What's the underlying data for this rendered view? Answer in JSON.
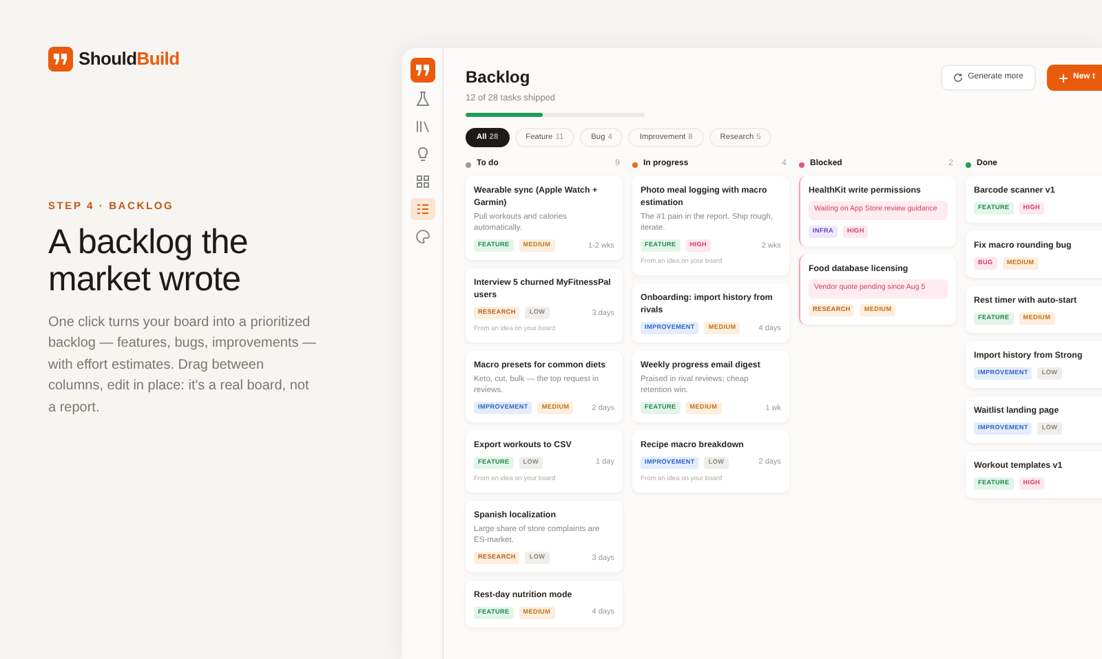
{
  "brand": {
    "name": "Should",
    "accent": "Build"
  },
  "intro": {
    "step": "STEP 4 · BACKLOG",
    "heading": "A backlog the market wrote",
    "body": "One click turns your board into a prioritized backlog — features, bugs, improvements — with effort estimates. Drag between columns, edit in place: it's a real board, not a report."
  },
  "sidebar": {
    "items": [
      {
        "kind": "flask",
        "selected": false
      },
      {
        "kind": "books",
        "selected": false
      },
      {
        "kind": "bulb",
        "selected": false
      },
      {
        "kind": "grid",
        "selected": false
      },
      {
        "kind": "list",
        "selected": true
      },
      {
        "kind": "palette",
        "selected": false
      }
    ]
  },
  "board": {
    "title": "Backlog",
    "subtitle": "12 of 28 tasks shipped",
    "progress": {
      "level": 0.43
    },
    "actions": [
      {
        "kind": "secondary",
        "label": "Generate more"
      },
      {
        "kind": "primary",
        "label": "New t"
      }
    ],
    "filters": [
      {
        "label": "All",
        "count": "28",
        "selected": true
      },
      {
        "label": "Feature",
        "count": "11",
        "selected": false
      },
      {
        "label": "Bug",
        "count": "4",
        "selected": false
      },
      {
        "label": "Improvement",
        "count": "8",
        "selected": false
      },
      {
        "label": "Research",
        "count": "5",
        "selected": false
      }
    ],
    "columns": [
      {
        "title": "To do",
        "count": "9",
        "color": "#9e9a94",
        "cards": [
          {
            "title": "Wearable sync (Apple Watch + Garmin)",
            "description": "Pull workouts and calories automatically.",
            "tags": [
              {
                "kind": "feature",
                "label": "FEATURE"
              },
              {
                "kind": "medium",
                "label": "MEDIUM"
              }
            ],
            "estimate": "1-2 wks"
          },
          {
            "title": "Interview 5 churned MyFitnessPal users",
            "tags": [
              {
                "kind": "research",
                "label": "RESEARCH"
              },
              {
                "kind": "low",
                "label": "LOW"
              }
            ],
            "estimate": "3 days",
            "note": "From an idea on your board"
          },
          {
            "title": "Macro presets for common diets",
            "description": "Keto, cut, bulk — the top request in reviews.",
            "tags": [
              {
                "kind": "improvement",
                "label": "IMPROVEMENT"
              },
              {
                "kind": "medium",
                "label": "MEDIUM"
              }
            ],
            "estimate": "2 days"
          },
          {
            "title": "Export workouts to CSV",
            "tags": [
              {
                "kind": "feature",
                "label": "FEATURE"
              },
              {
                "kind": "low",
                "label": "LOW"
              }
            ],
            "estimate": "1 day",
            "note": "From an idea on your board"
          },
          {
            "title": "Spanish localization",
            "description": "Large share of store complaints are ES-market.",
            "tags": [
              {
                "kind": "research",
                "label": "RESEARCH"
              },
              {
                "kind": "low",
                "label": "LOW"
              }
            ],
            "estimate": "3 days"
          },
          {
            "title": "Rest-day nutrition mode",
            "tags": [
              {
                "kind": "feature",
                "label": "FEATURE"
              },
              {
                "kind": "medium",
                "label": "MEDIUM"
              }
            ],
            "estimate": "4 days"
          }
        ]
      },
      {
        "title": "In progress",
        "count": "4",
        "color": "#ea6a1f",
        "cards": [
          {
            "title": "Photo meal logging with macro estimation",
            "description": "The #1 pain in the report. Ship rough, iterate.",
            "tags": [
              {
                "kind": "feature",
                "label": "FEATURE"
              },
              {
                "kind": "high",
                "label": "HIGH"
              }
            ],
            "estimate": "2 wks",
            "note": "From an idea on your board"
          },
          {
            "title": "Onboarding: import history from rivals",
            "tags": [
              {
                "kind": "improvement",
                "label": "IMPROVEMENT"
              },
              {
                "kind": "medium",
                "label": "MEDIUM"
              }
            ],
            "estimate": "4 days"
          },
          {
            "title": "Weekly progress email digest",
            "description": "Praised in rival reviews; cheap retention win.",
            "tags": [
              {
                "kind": "feature",
                "label": "FEATURE"
              },
              {
                "kind": "medium",
                "label": "MEDIUM"
              }
            ],
            "estimate": "1 wk"
          },
          {
            "title": "Recipe macro breakdown",
            "tags": [
              {
                "kind": "improvement",
                "label": "IMPROVEMENT"
              },
              {
                "kind": "low",
                "label": "LOW"
              }
            ],
            "estimate": "2 days",
            "note": "From an idea on your board"
          }
        ]
      },
      {
        "title": "Blocked",
        "count": "2",
        "color": "#e8567a",
        "cards": [
          {
            "title": "HealthKit write permissions",
            "blocker": "Waiting on App Store review guidance",
            "tags": [
              {
                "kind": "infra",
                "label": "INFRA"
              },
              {
                "kind": "high",
                "label": "HIGH"
              }
            ]
          },
          {
            "title": "Food database licensing",
            "blocker": "Vendor quote pending since Aug 5",
            "tags": [
              {
                "kind": "research",
                "label": "RESEARCH"
              },
              {
                "kind": "medium",
                "label": "MEDIUM"
              }
            ]
          }
        ]
      },
      {
        "title": "Done",
        "color": "#1f9d57",
        "cards": [
          {
            "title": "Barcode scanner v1",
            "tags": [
              {
                "kind": "feature",
                "label": "FEATURE"
              },
              {
                "kind": "high",
                "label": "HIGH"
              }
            ]
          },
          {
            "title": "Fix macro rounding bug",
            "tags": [
              {
                "kind": "bug",
                "label": "BUG"
              },
              {
                "kind": "medium",
                "label": "MEDIUM"
              }
            ]
          },
          {
            "title": "Rest timer with auto-start",
            "tags": [
              {
                "kind": "feature",
                "label": "FEATURE"
              },
              {
                "kind": "medium",
                "label": "MEDIUM"
              }
            ]
          },
          {
            "title": "Import history from Strong",
            "tags": [
              {
                "kind": "improvement",
                "label": "IMPROVEMENT"
              },
              {
                "kind": "low",
                "label": "LOW"
              }
            ]
          },
          {
            "title": "Waitlist landing page",
            "tags": [
              {
                "kind": "improvement",
                "label": "IMPROVEMENT"
              },
              {
                "kind": "low",
                "label": "LOW"
              }
            ]
          },
          {
            "title": "Workout templates v1",
            "tags": [
              {
                "kind": "feature",
                "label": "FEATURE"
              },
              {
                "kind": "high",
                "label": "HIGH"
              }
            ]
          }
        ]
      }
    ]
  }
}
